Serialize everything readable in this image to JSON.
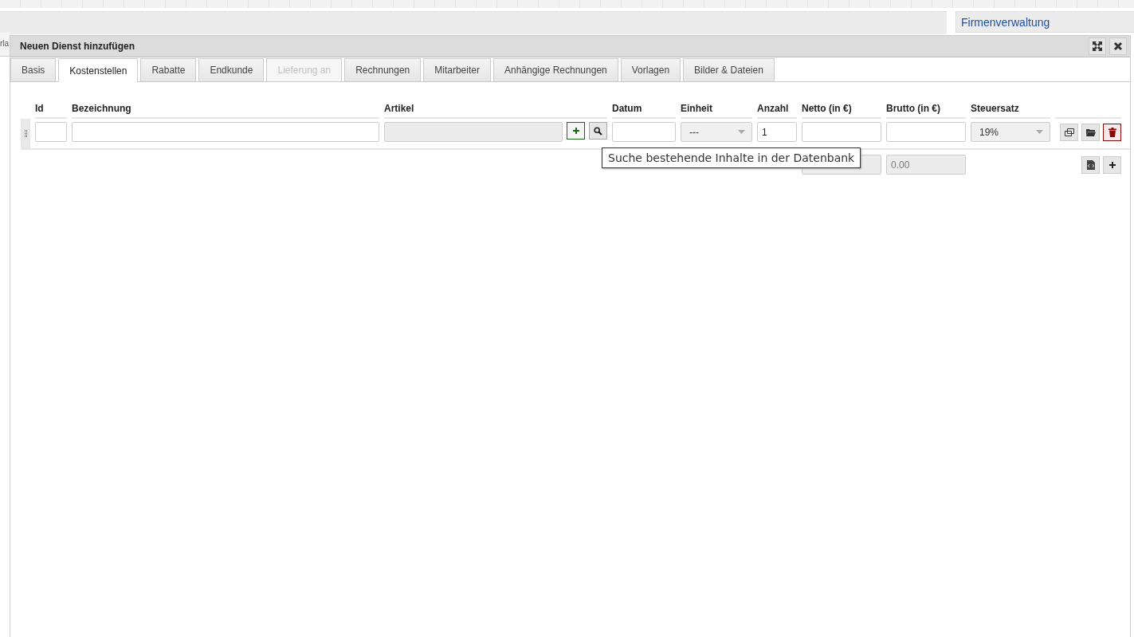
{
  "background": {
    "left_tab_fragment": "rla",
    "panel_title": "Firmenverwaltung"
  },
  "dialog": {
    "title": "Neuen Dienst hinzufügen"
  },
  "tabs": [
    {
      "label": "Basis",
      "selected": false,
      "disabled": false
    },
    {
      "label": "Kostenstellen",
      "selected": true,
      "disabled": false
    },
    {
      "label": "Rabatte",
      "selected": false,
      "disabled": false
    },
    {
      "label": "Endkunde",
      "selected": false,
      "disabled": false
    },
    {
      "label": "Lieferung an",
      "selected": false,
      "disabled": true
    },
    {
      "label": "Rechnungen",
      "selected": false,
      "disabled": false
    },
    {
      "label": "Mitarbeiter",
      "selected": false,
      "disabled": false
    },
    {
      "label": "Anhängige Rechnungen",
      "selected": false,
      "disabled": false
    },
    {
      "label": "Vorlagen",
      "selected": false,
      "disabled": false
    },
    {
      "label": "Bilder & Dateien",
      "selected": false,
      "disabled": false
    }
  ],
  "table": {
    "columns": [
      "Id",
      "Bezeichnung",
      "Artikel",
      "Datum",
      "Einheit",
      "Anzahl",
      "Netto (in €)",
      "Brutto (in €)",
      "Steuersatz"
    ],
    "rows": [
      {
        "einheit": "---",
        "anzahl": "1",
        "steuersatz": "19%"
      }
    ],
    "totals": {
      "brutto": "0.00"
    }
  },
  "tooltip": "Suche bestehende Inhalte in der Datenbank"
}
